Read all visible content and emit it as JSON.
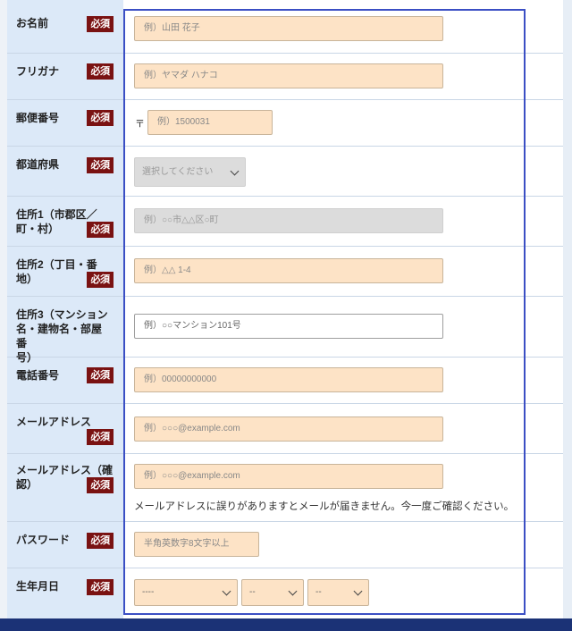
{
  "required_badge": "必須",
  "fields": {
    "name": {
      "label": "お名前",
      "placeholder": "例）山田 花子"
    },
    "furigana": {
      "label": "フリガナ",
      "placeholder": "例）ヤマダ ハナコ"
    },
    "postal": {
      "label": "郵便番号",
      "prefix": "〒",
      "placeholder": "例）1500031"
    },
    "prefecture": {
      "label": "都道府県",
      "selected": "選択してください"
    },
    "address1": {
      "label_line1": "住所1（市郡区／",
      "label_line2": "町・村）",
      "placeholder": "例）○○市△△区○町"
    },
    "address2": {
      "label_line1": "住所2（丁目・番",
      "label_line2": "地）",
      "placeholder": "例）△△ 1-4"
    },
    "address3": {
      "label_line1": "住所3（マンション",
      "label_line2": "名・建物名・部屋番",
      "label_line3": "号）",
      "placeholder": "例）○○マンション101号"
    },
    "phone": {
      "label": "電話番号",
      "placeholder": "例）00000000000"
    },
    "email": {
      "label": "メールアドレス",
      "placeholder": "例）○○○@example.com"
    },
    "email_confirm": {
      "label_line1": "メールアドレス（確",
      "label_line2": "認）",
      "placeholder": "例）○○○@example.com",
      "note": "メールアドレスに誤りがありますとメールが届きません。今一度ご確認ください。"
    },
    "password": {
      "label": "パスワード",
      "placeholder": "半角英数字8文字以上"
    },
    "birthdate": {
      "label": "生年月日",
      "year": "----",
      "month": "--",
      "day": "--"
    }
  },
  "colors": {
    "input_bg": "#fde3c6",
    "label_bg": "#dce9f8",
    "badge": "#7a1212",
    "frame": "#3b4fc4",
    "footer": "#1b3276"
  }
}
